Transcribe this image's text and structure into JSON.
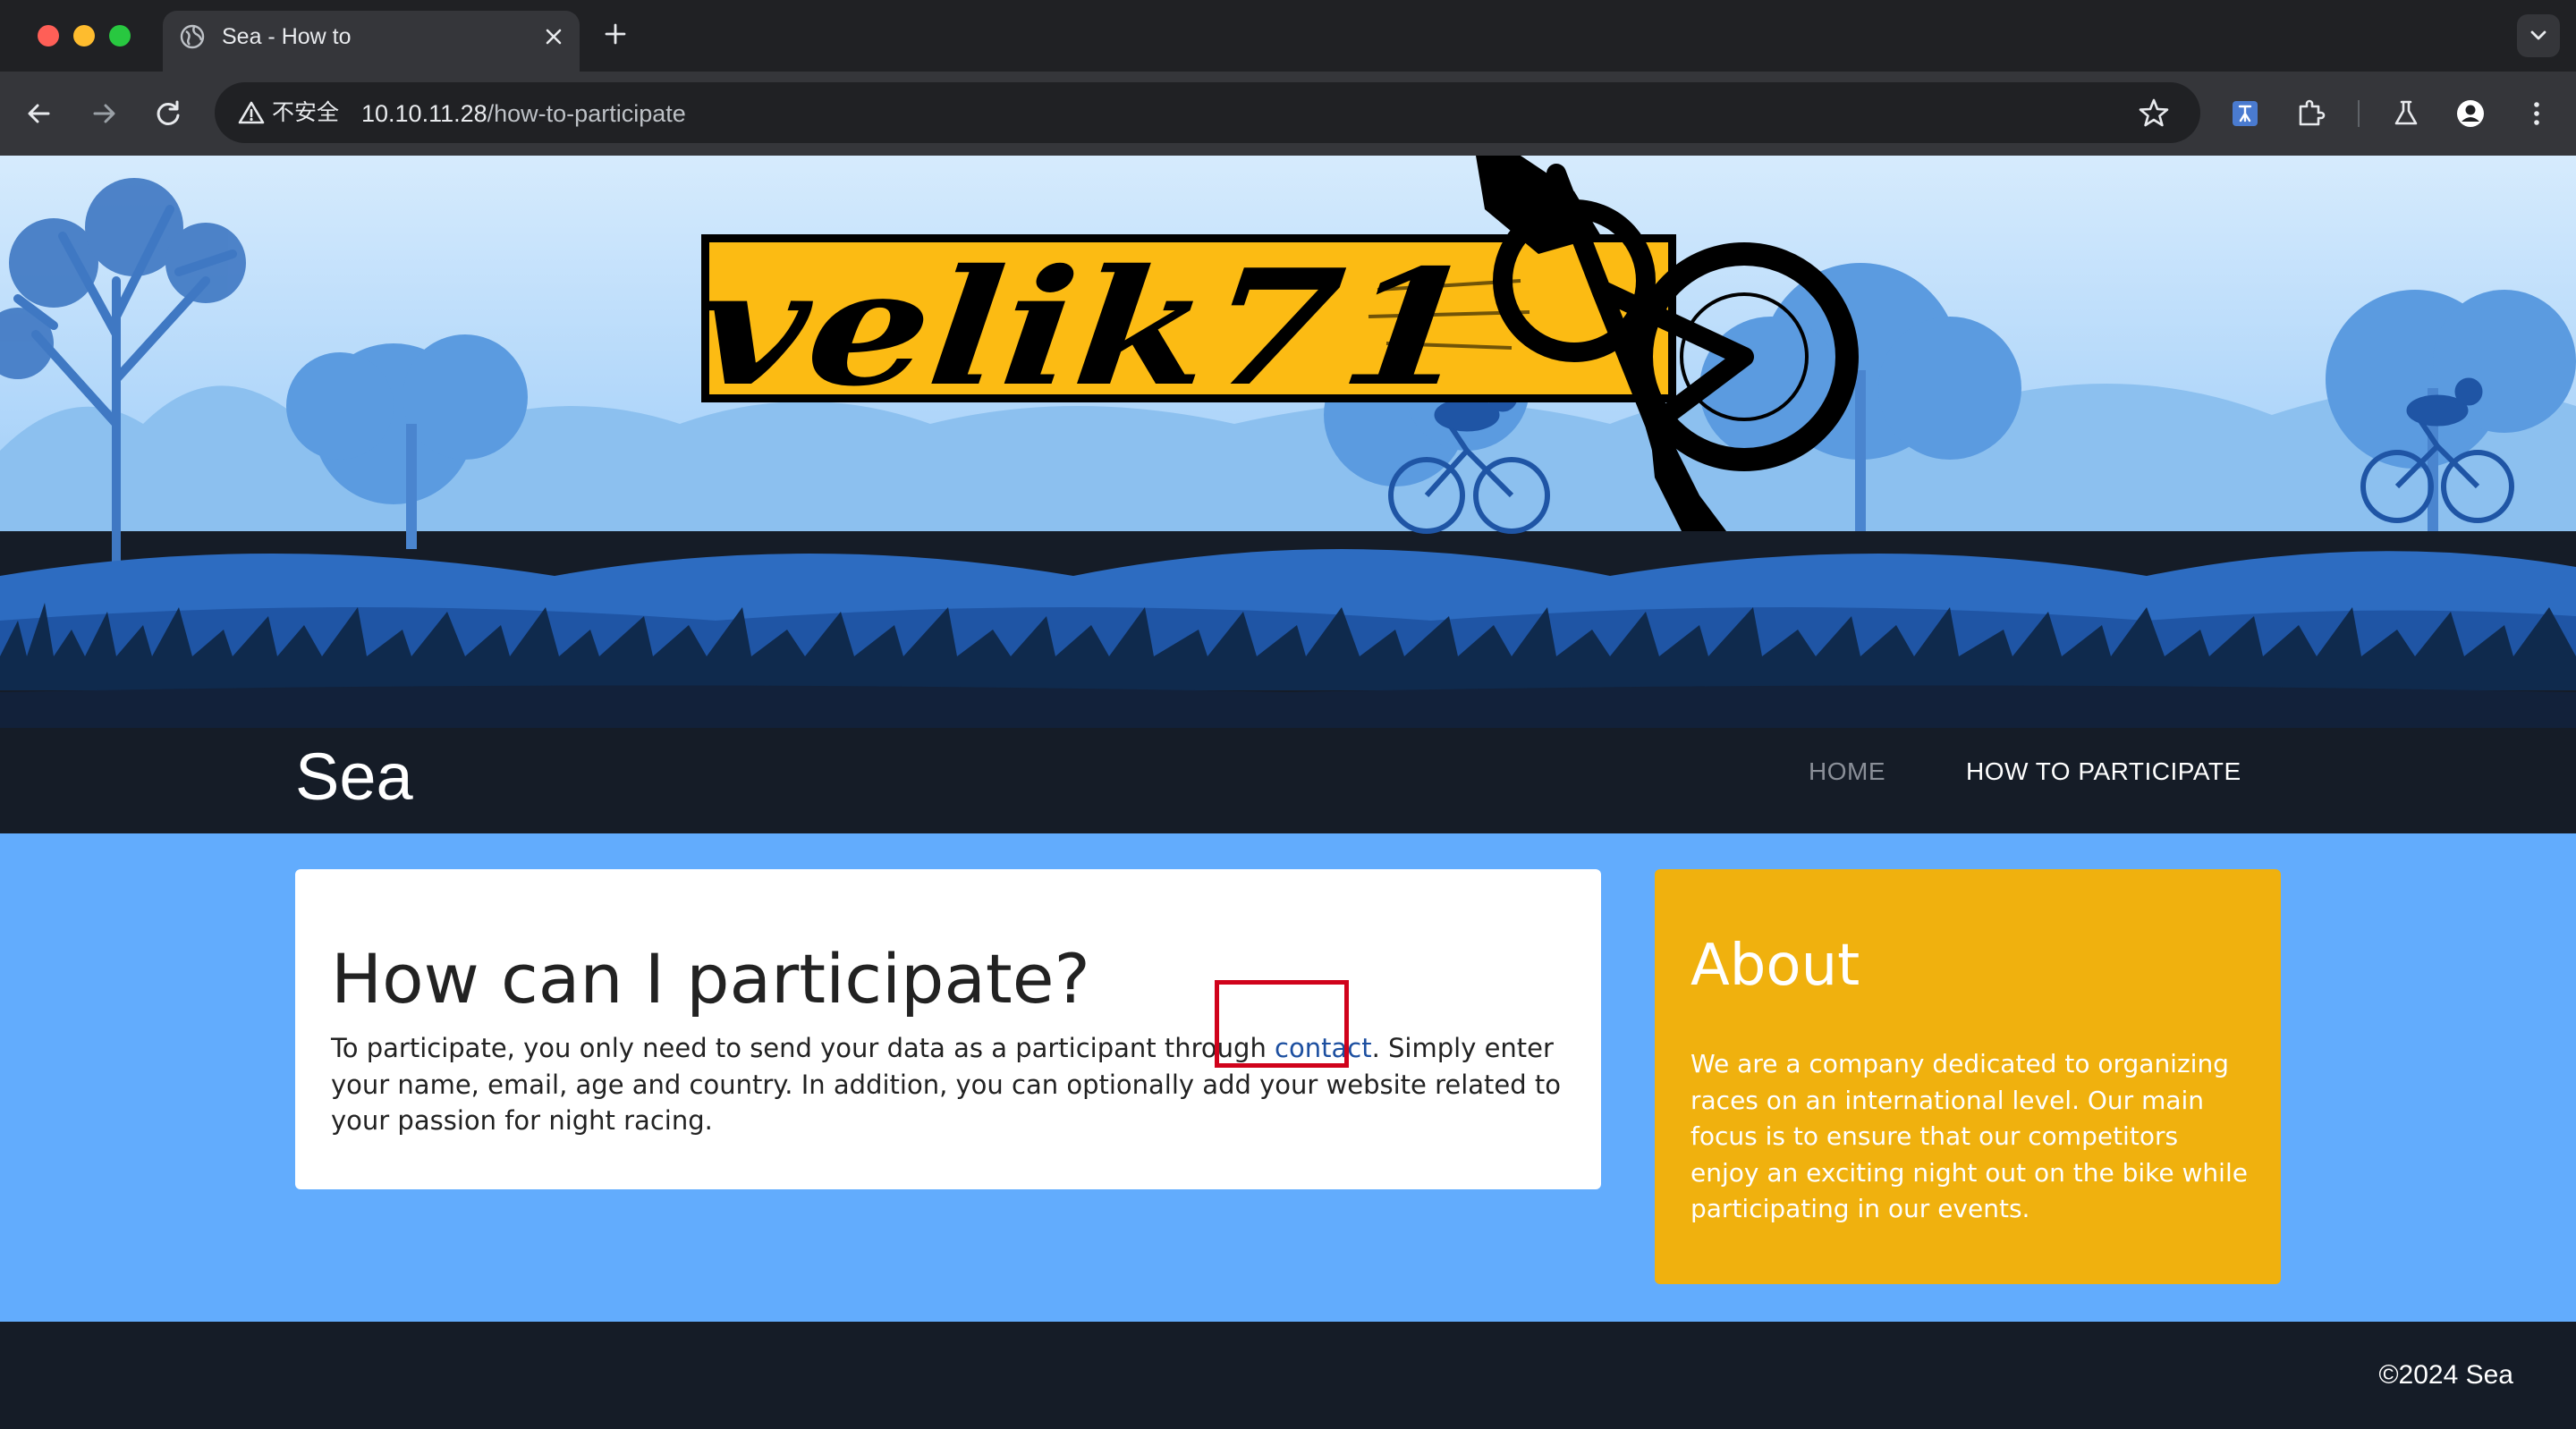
{
  "browser": {
    "tab_title": "Sea - How to",
    "security_label": "不安全",
    "url_host": "10.10.11.28",
    "url_path": "/how-to-participate"
  },
  "site": {
    "logo_text": "velik71",
    "title": "Sea",
    "nav": {
      "home": "HOME",
      "how_to_participate": "HOW TO PARTICIPATE"
    }
  },
  "main": {
    "heading": "How can I participate?",
    "text_before_link": "To participate, you only need to send your data as a participant through ",
    "link_text": "contact",
    "text_after_link": ". Simply enter your name, email, age and country. In addition, you can optionally add your website related to your passion for night racing."
  },
  "about": {
    "heading": "About",
    "text": "We are a company dedicated to organizing races on an international level. Our main focus is to ensure that our competitors enjoy an exciting night out on the bike while participating in our events."
  },
  "footer": {
    "copyright": "©2024 Sea"
  },
  "colors": {
    "header_dark": "#151c27",
    "content_blue": "#62acfd",
    "about_yellow": "#f0b10e",
    "highlight_red": "#d0021b"
  }
}
